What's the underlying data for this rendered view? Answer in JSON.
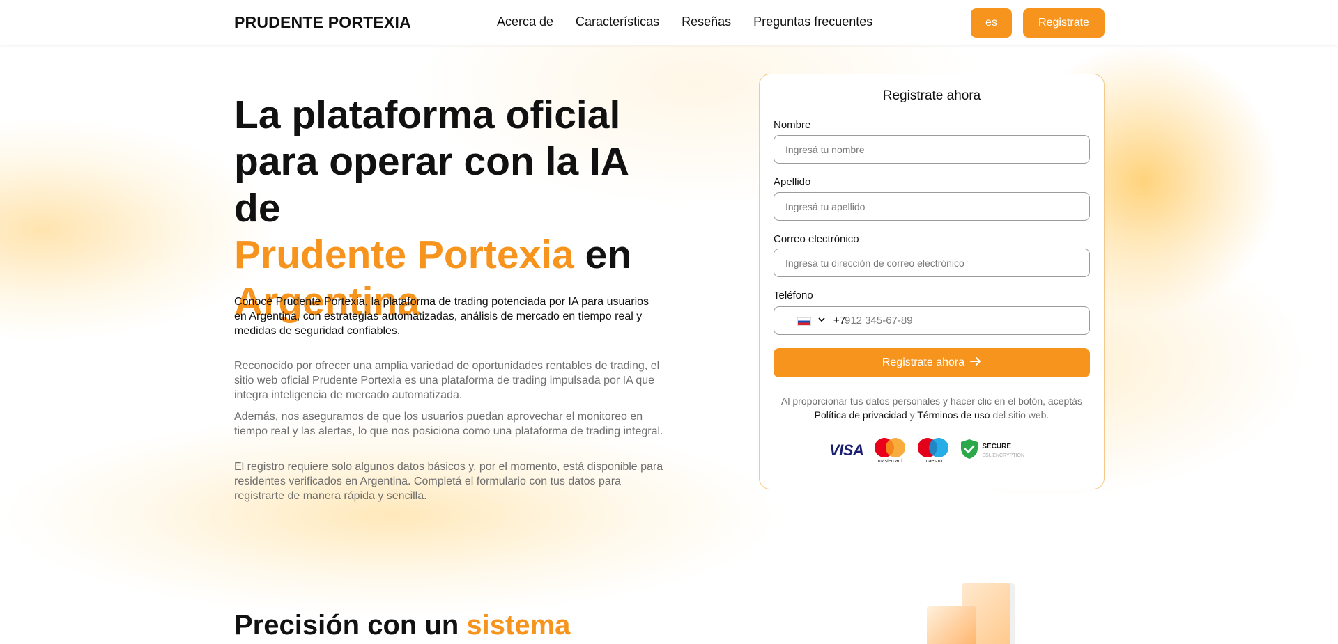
{
  "header": {
    "logo": "PRUDENTE PORTEXIA",
    "nav": [
      "Acerca de",
      "Características",
      "Reseñas",
      "Preguntas frecuentes"
    ],
    "lang": "es",
    "register": "Registrate"
  },
  "hero": {
    "title_line1": "La plataforma oficial",
    "title_line2": "para operar con la IA de",
    "title_accent1": "Prudente Portexia",
    "title_mid": " en",
    "title_accent2": "Argentina",
    "lead": "Conocé Prudente Portexia, la plataforma de trading potenciada por IA para usuarios en Argentina, con estrategias automatizadas, análisis de mercado en tiempo real y medidas de seguridad confiables.",
    "paragraphs": [
      "Reconocido por ofrecer una amplia variedad de oportunidades rentables de trading, el sitio web oficial Prudente Portexia es una plataforma de trading impulsada por IA que integra inteligencia de mercado automatizada.",
      "Además, nos aseguramos de que los usuarios puedan aprovechar el monitoreo en tiempo real y las alertas, lo que nos posiciona como una plataforma de trading integral.",
      "El registro requiere solo algunos datos básicos y, por el momento, está disponible para residentes verificados en Argentina. Completá el formulario con tus datos para registrarte de manera rápida y sencilla."
    ]
  },
  "form": {
    "title": "Registrate ahora",
    "first_name_label": "Nombre",
    "first_name_placeholder": "Ingresá tu nombre",
    "last_name_label": "Apellido",
    "last_name_placeholder": "Ingresá tu apellido",
    "email_label": "Correo electrónico",
    "email_placeholder": "Ingresá tu dirección de correo electrónico",
    "phone_label": "Teléfono",
    "phone_code": "+7",
    "phone_placeholder": "912 345-67-89",
    "submit": "Registrate ahora",
    "consent_pre": "Al proporcionar tus datos personales y hacer clic en el botón, aceptás ",
    "privacy": "Política de privacidad",
    "consent_and": " y ",
    "terms": "Términos de uso",
    "consent_post": " del sitio web.",
    "badges": {
      "visa": "VISA",
      "mastercard": "mastercard",
      "maestro": "maestro",
      "secure": "SECURE",
      "ssl": "SSL ENCRYPTION"
    }
  },
  "section2": {
    "title": "Precisión con un ",
    "title_accent": "sistema"
  },
  "colors": {
    "accent": "#f7941d",
    "text": "#111111",
    "muted": "#6e6e6e"
  }
}
